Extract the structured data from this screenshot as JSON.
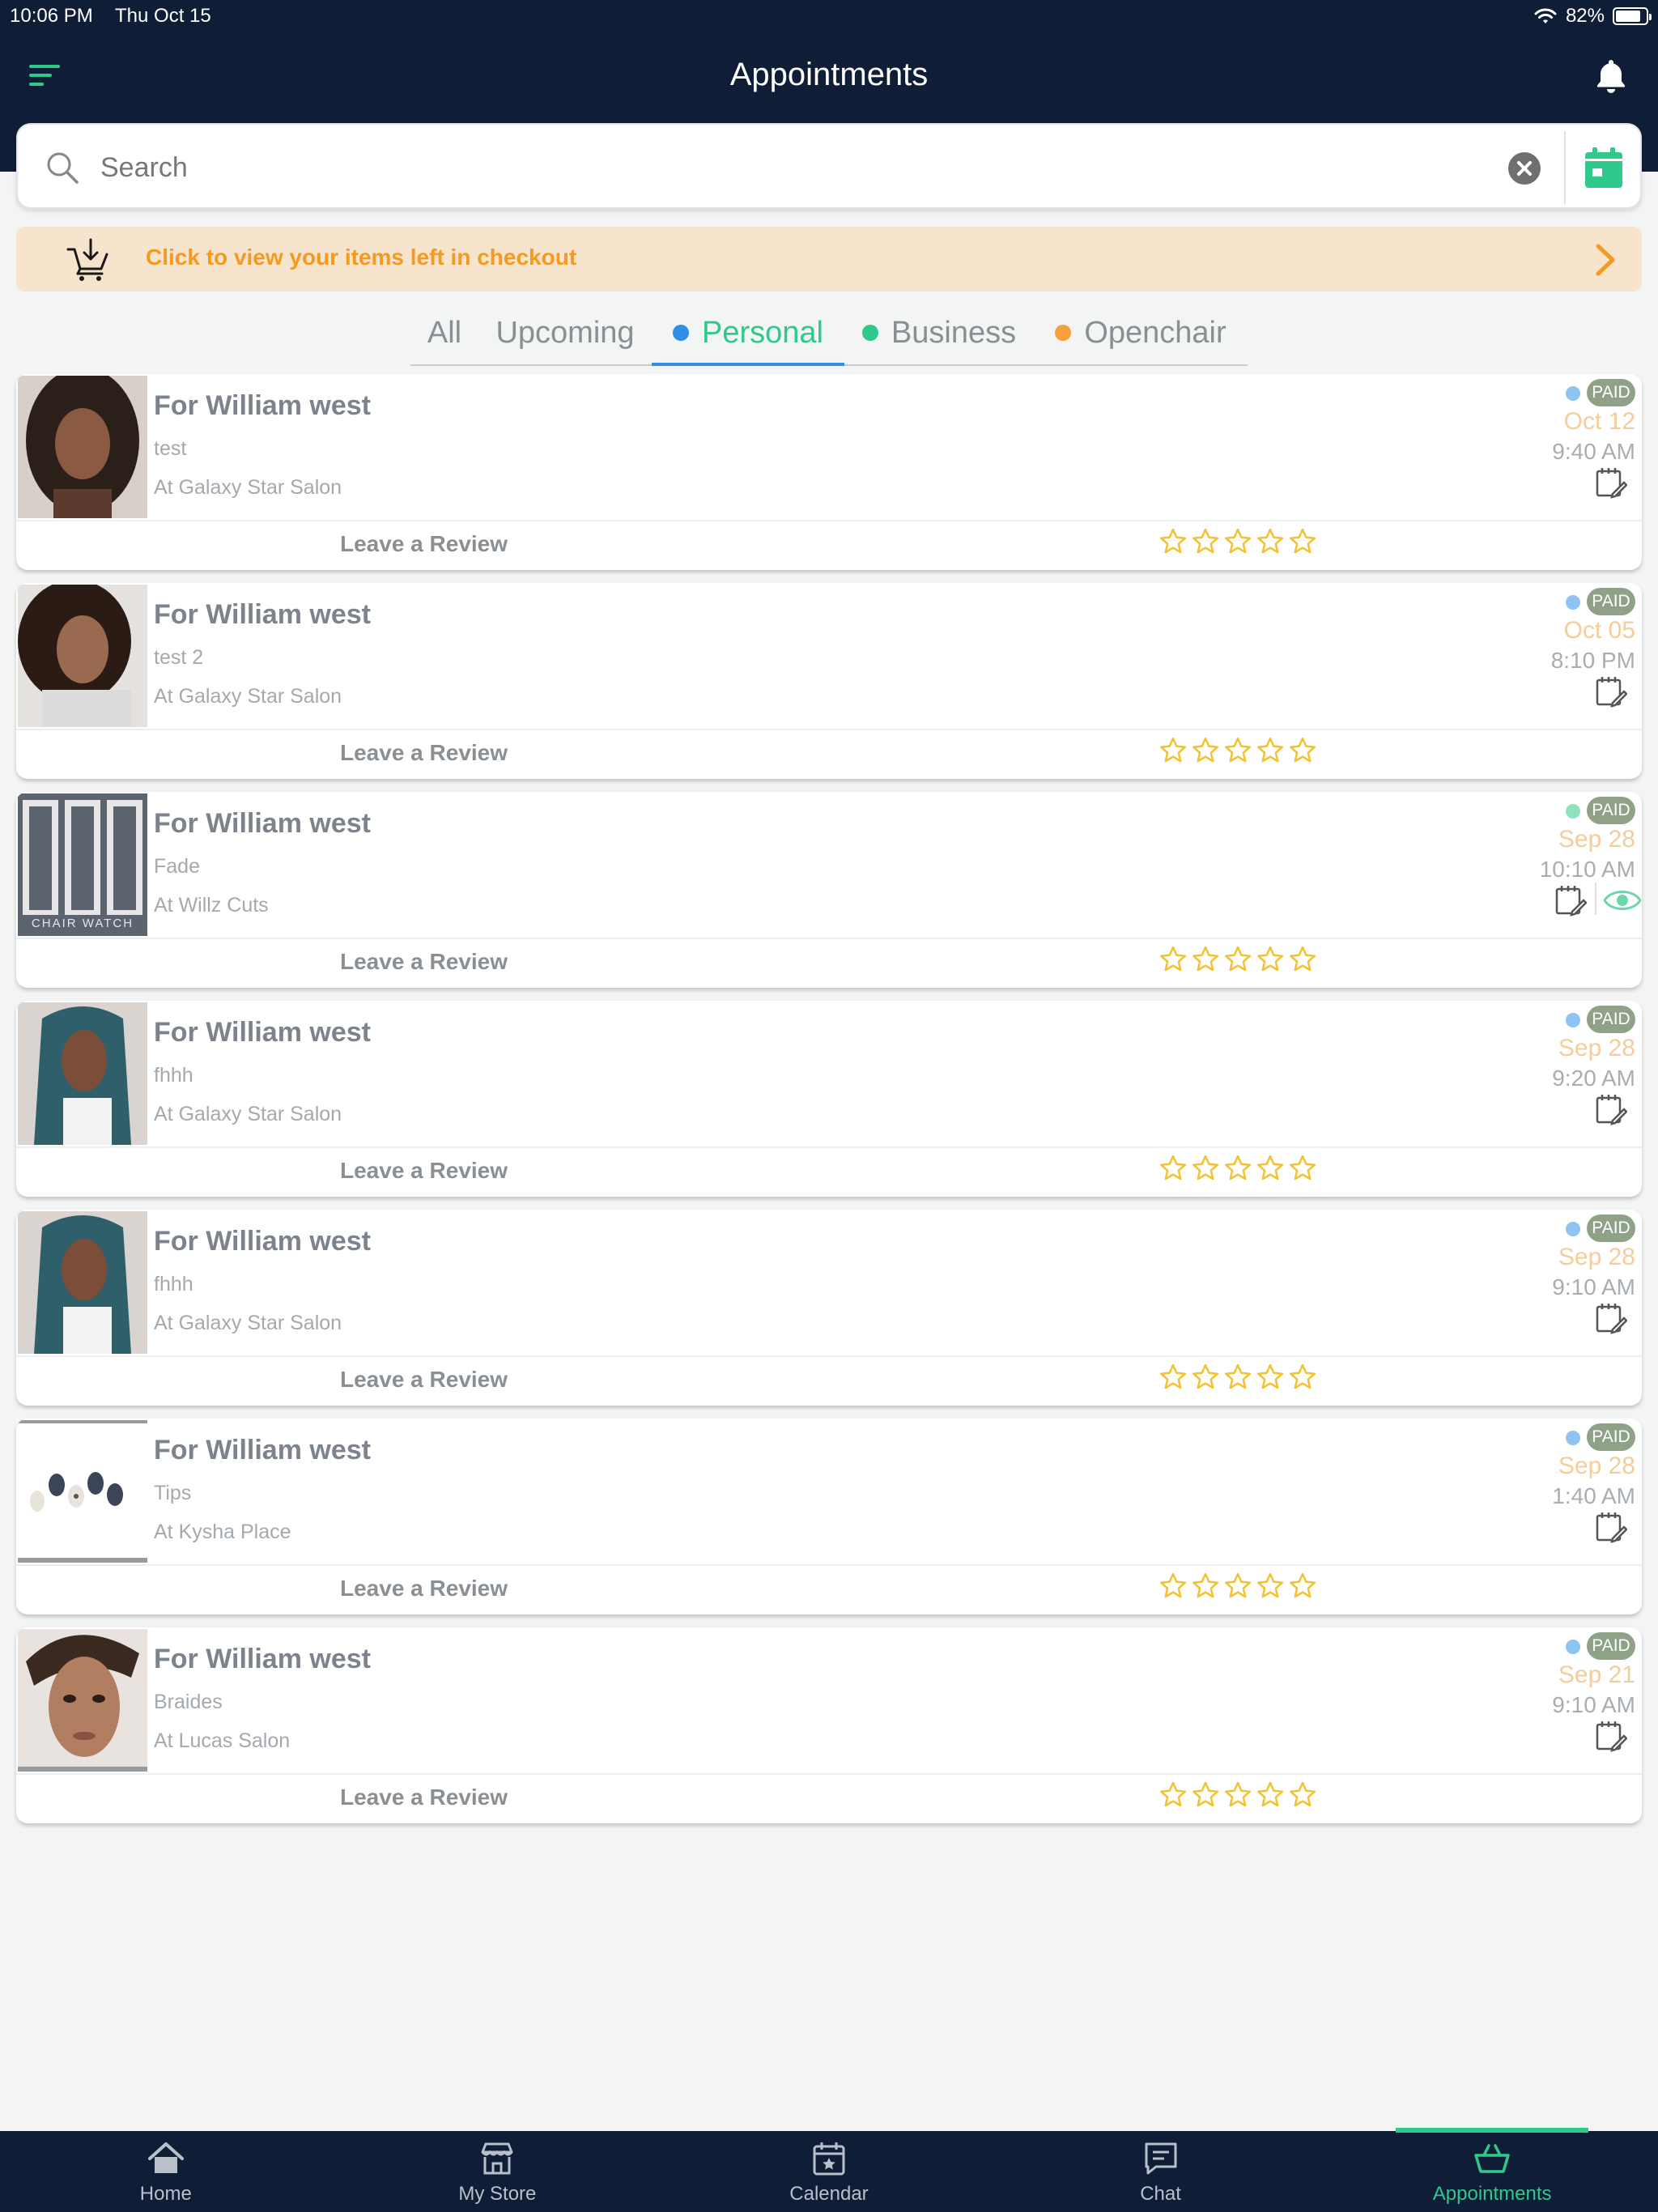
{
  "status_bar": {
    "time": "10:06 PM",
    "date": "Thu Oct 15",
    "battery": "82%"
  },
  "header": {
    "title": "Appointments"
  },
  "search": {
    "placeholder": "Search"
  },
  "checkout_banner": {
    "text": "Click to view your items left in checkout"
  },
  "tabs": [
    {
      "label": "All"
    },
    {
      "label": "Upcoming"
    },
    {
      "label": "Personal",
      "dot_color": "#2f8ee6"
    },
    {
      "label": "Business",
      "dot_color": "#2ec98b"
    },
    {
      "label": "Openchair",
      "dot_color": "#f5a03a"
    }
  ],
  "appointments": [
    {
      "name": "For William west",
      "service": "test",
      "location": "At Galaxy Star Salon",
      "badge": "PAID",
      "date": "Oct 12",
      "time": "9:40 AM",
      "review_label": "Leave a Review",
      "status_color": "#8ec3f2"
    },
    {
      "name": "For William west",
      "service": "test 2",
      "location": "At Galaxy Star Salon",
      "badge": "PAID",
      "date": "Oct 05",
      "time": "8:10 PM",
      "review_label": "Leave a Review",
      "status_color": "#8ec3f2"
    },
    {
      "name": "For William west",
      "service": "Fade",
      "location": "At Willz Cuts",
      "badge": "PAID",
      "date": "Sep 28",
      "time": "10:10 AM",
      "review_label": "Leave a Review",
      "status_color": "#8ee3bd",
      "thumb_text": "CHAIR WATCH"
    },
    {
      "name": "For William west",
      "service": "fhhh",
      "location": "At Galaxy Star Salon",
      "badge": "PAID",
      "date": "Sep 28",
      "time": "9:20 AM",
      "review_label": "Leave a Review",
      "status_color": "#8ec3f2"
    },
    {
      "name": "For William west",
      "service": "fhhh",
      "location": "At Galaxy Star Salon",
      "badge": "PAID",
      "date": "Sep 28",
      "time": "9:10 AM",
      "review_label": "Leave a Review",
      "status_color": "#8ec3f2"
    },
    {
      "name": "For William west",
      "service": "Tips",
      "location": "At Kysha Place",
      "badge": "PAID",
      "date": "Sep 28",
      "time": "1:40 AM",
      "review_label": "Leave a Review",
      "status_color": "#8ec3f2"
    },
    {
      "name": "For William west",
      "service": "Braides",
      "location": "At Lucas Salon",
      "badge": "PAID",
      "date": "Sep 21",
      "time": "9:10 AM",
      "review_label": "Leave a Review",
      "status_color": "#8ec3f2"
    }
  ],
  "bottom_nav": [
    {
      "label": "Home",
      "icon": "home-icon"
    },
    {
      "label": "My Store",
      "icon": "store-icon"
    },
    {
      "label": "Calendar",
      "icon": "calendar-icon"
    },
    {
      "label": "Chat",
      "icon": "chat-icon"
    },
    {
      "label": "Appointments",
      "icon": "basket-icon"
    }
  ],
  "colors": {
    "header_bg": "#0f1d36",
    "accent_green": "#2ec98b",
    "accent_blue": "#2f8ee6",
    "accent_orange": "#f39a23",
    "star_yellow": "#f2c230"
  }
}
